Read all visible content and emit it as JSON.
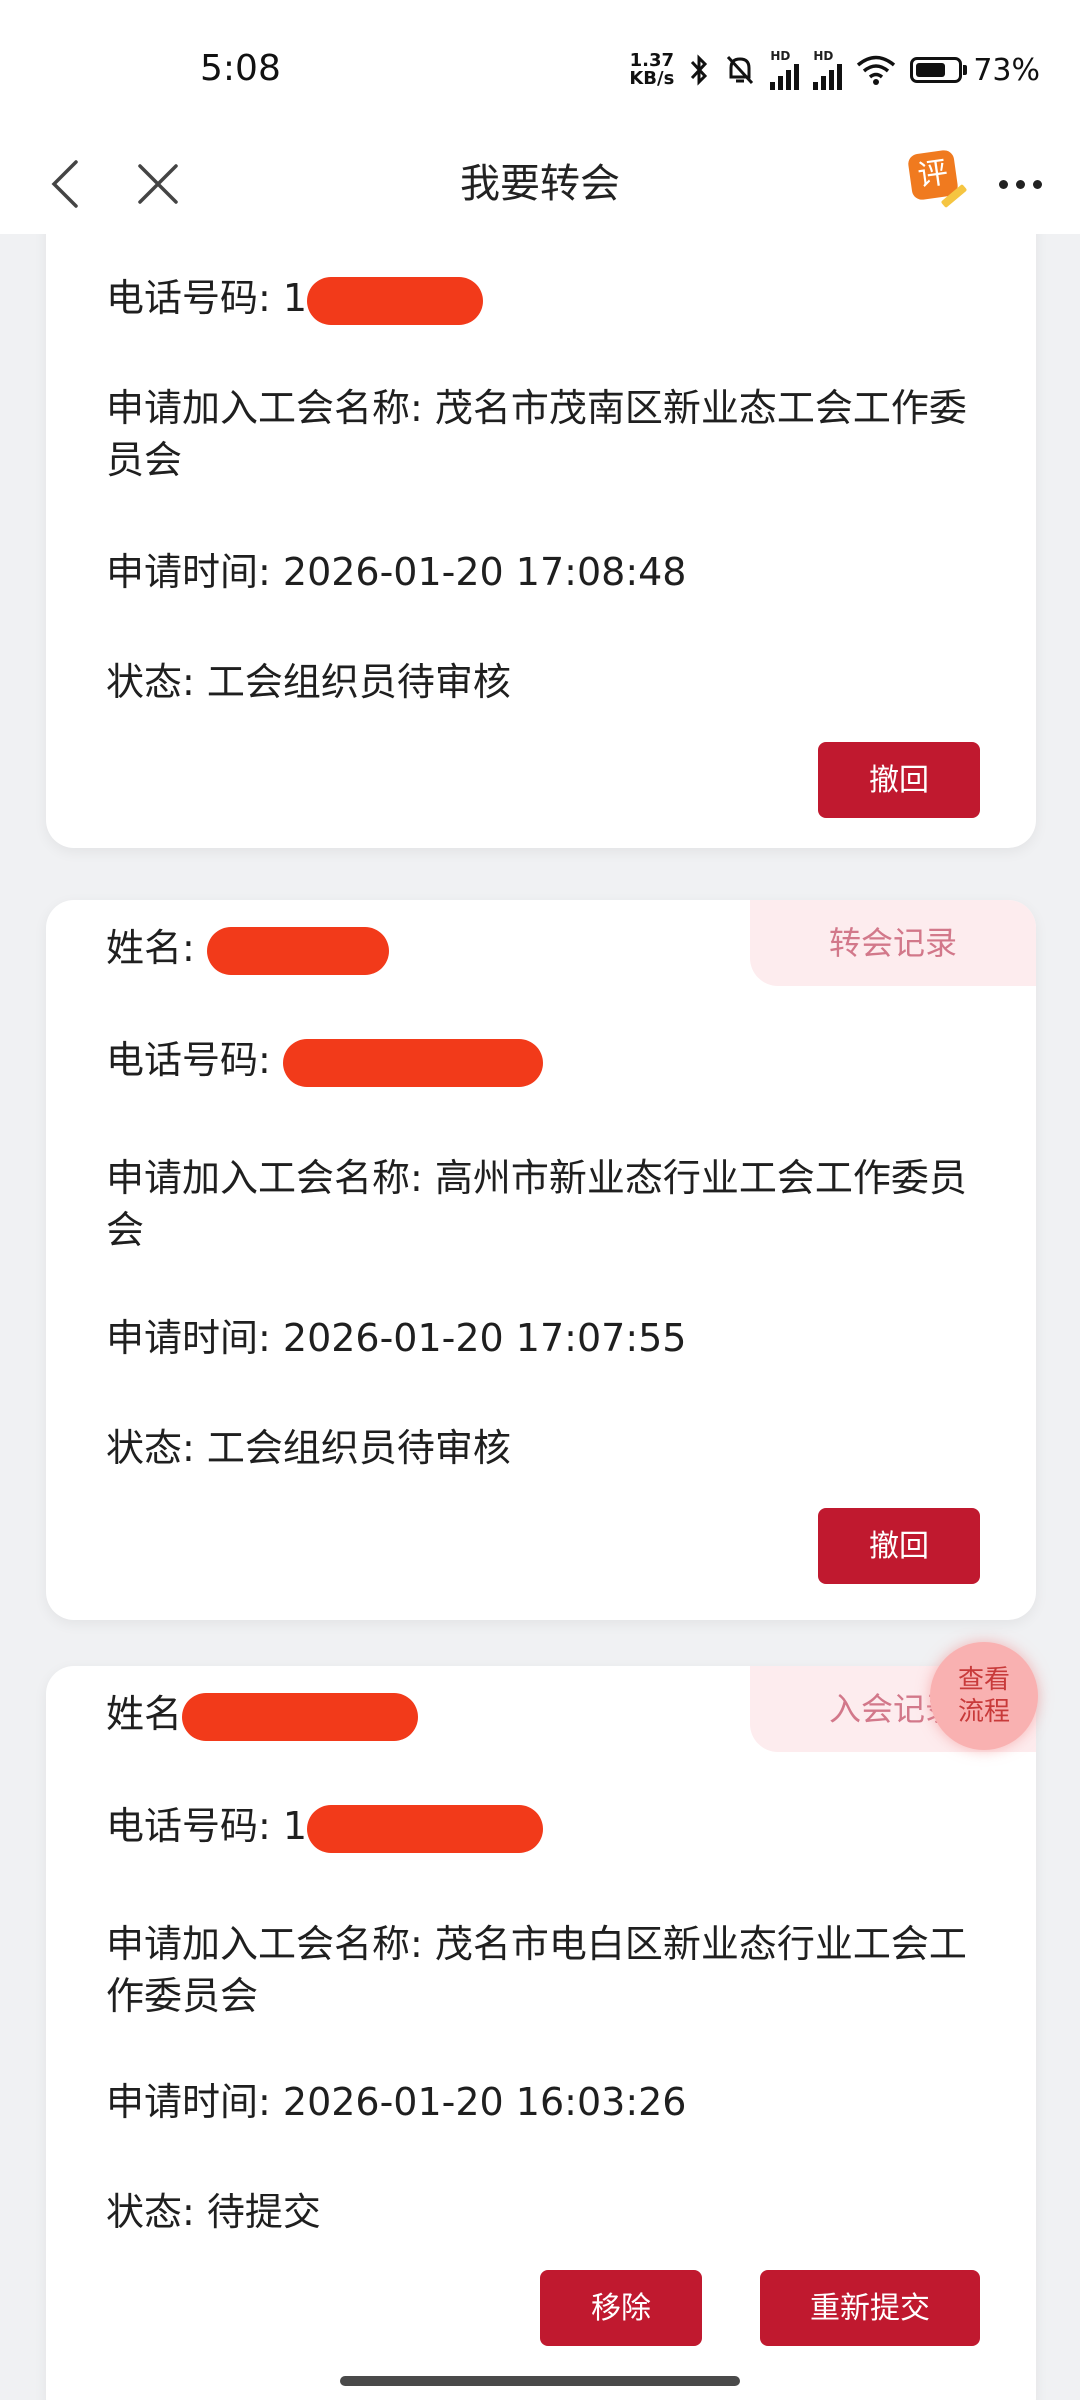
{
  "status_bar": {
    "time": "5:08",
    "net_speed_value": "1.37",
    "net_speed_unit": "KB/s",
    "signal_label_1": "HD",
    "signal_label_2": "HD",
    "battery_percent": "73%",
    "battery_level": 0.73
  },
  "navbar": {
    "title": "我要转会",
    "rate_icon_glyph": "评"
  },
  "cards": [
    {
      "phone_label": "电话号码: ",
      "phone_visible": "1",
      "union_label": "申请加入工会名称: ",
      "union_name": "茂名市茂南区新业态工会工作委员会",
      "time_label": "申请时间: ",
      "time_value": "2026-01-20 17:08:48",
      "status_label": "状态: ",
      "status_value": "工会组织员待审核",
      "button_withdraw": "撤回"
    },
    {
      "tag": "转会记录",
      "name_label": "姓名: ",
      "phone_label": "电话号码: ",
      "union_label": "申请加入工会名称: ",
      "union_name": "高州市新业态行业工会工作委员会",
      "time_label": "申请时间: ",
      "time_value": "2026-01-20 17:07:55",
      "status_label": "状态: ",
      "status_value": "工会组织员待审核",
      "button_withdraw": "撤回"
    },
    {
      "tag": "入会记录",
      "name_label": "姓名",
      "phone_label": "电话号码: ",
      "phone_visible": "1",
      "union_label": "申请加入工会名称: ",
      "union_name": "茂名市电白区新业态行业工会工作委员会",
      "time_label": "申请时间: ",
      "time_value": "2026-01-20 16:03:26",
      "status_label": "状态: ",
      "status_value": "待提交",
      "button_remove": "移除",
      "button_resubmit": "重新提交"
    }
  ],
  "floating_button": {
    "line1": "查看",
    "line2": "流程"
  },
  "colors": {
    "primary_button": "#c0192f",
    "tag_background": "#fdecee",
    "tag_text": "#d2788a",
    "redaction": "#f23a1a",
    "page_background": "#f0f1f3"
  }
}
